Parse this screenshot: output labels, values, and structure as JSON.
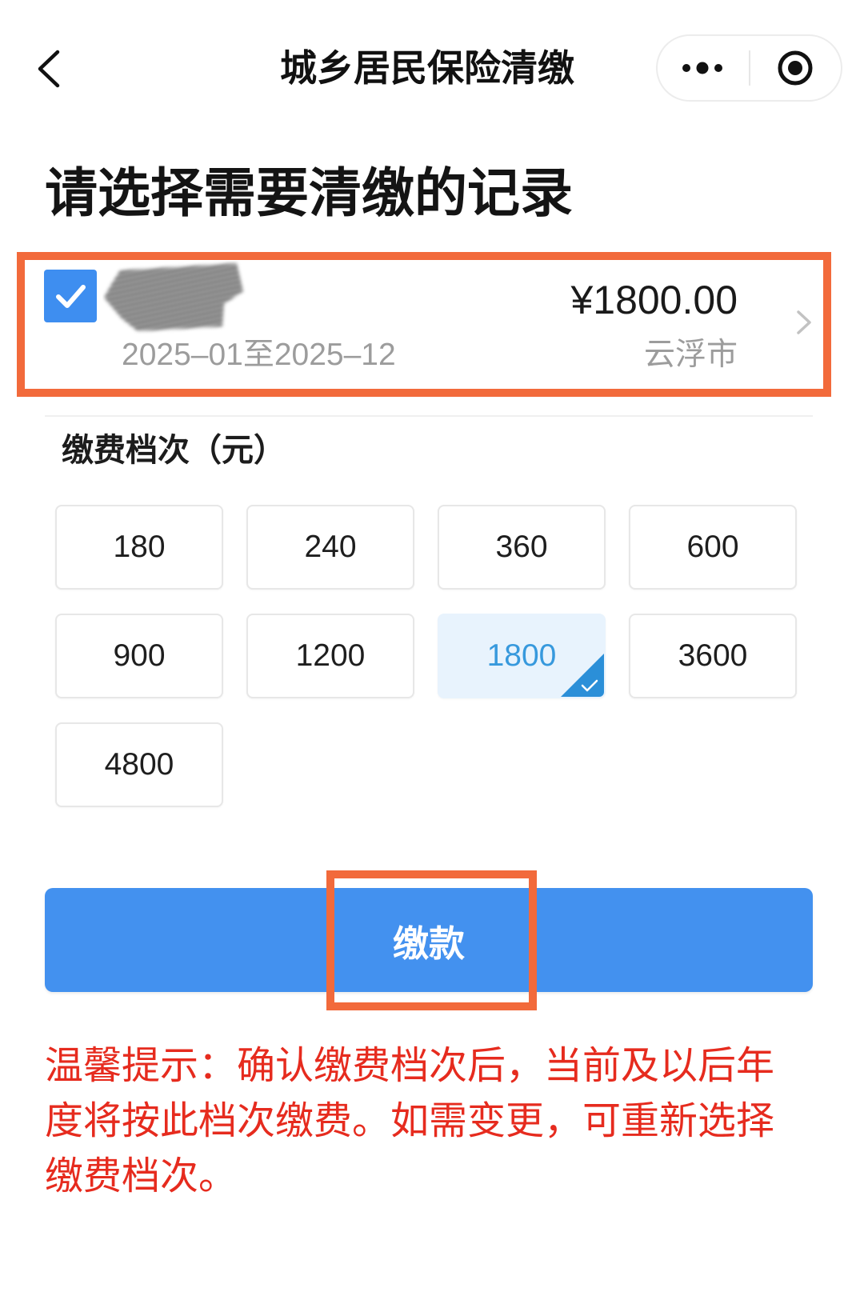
{
  "header": {
    "title": "城乡居民保险清缴",
    "back_icon": "chevron-left-icon",
    "more_icon": "more-dots-icon",
    "mini_program_icon": "target-icon"
  },
  "page": {
    "heading": "请选择需要清缴的记录"
  },
  "record": {
    "checked": true,
    "name_redacted": true,
    "amount": "¥1800.00",
    "period": "2025–01至2025–12",
    "city": "云浮市",
    "arrow_icon": "chevron-right-icon"
  },
  "tier_section": {
    "label": "缴费档次（元）",
    "options": [
      {
        "value": "180",
        "selected": false
      },
      {
        "value": "240",
        "selected": false
      },
      {
        "value": "360",
        "selected": false
      },
      {
        "value": "600",
        "selected": false
      },
      {
        "value": "900",
        "selected": false
      },
      {
        "value": "1200",
        "selected": false
      },
      {
        "value": "1800",
        "selected": true
      },
      {
        "value": "3600",
        "selected": false
      },
      {
        "value": "4800",
        "selected": false
      }
    ]
  },
  "pay_button": {
    "label": "缴款"
  },
  "tip": {
    "text": "温馨提示：确认缴费档次后，当前及以后年度将按此档次缴费。如需变更，可重新选择缴费档次。"
  },
  "colors": {
    "primary": "#4391ef",
    "checkbox": "#3e8ef0",
    "selected_bg": "#e8f3fd",
    "selected_text": "#3799dd",
    "selected_corner": "#2b8fd8",
    "tip_red": "#e62b1e",
    "highlight_orange": "#f26a3b"
  }
}
